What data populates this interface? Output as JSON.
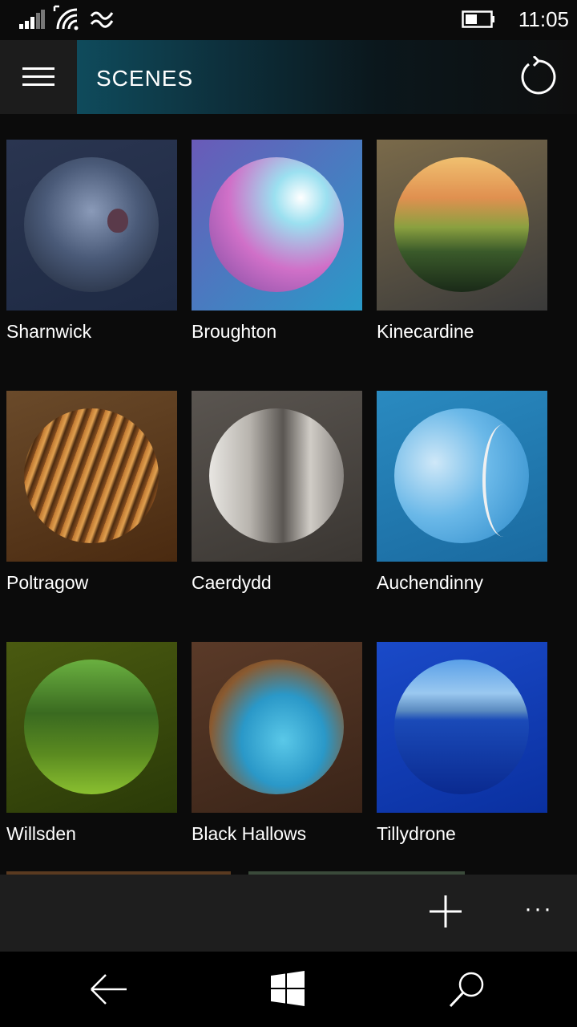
{
  "status_bar": {
    "time": "11:05",
    "icons": [
      "signal-icon",
      "wifi-icon",
      "data-icon",
      "battery-icon"
    ]
  },
  "header": {
    "title": "SCENES",
    "menu_icon": "hamburger-icon",
    "refresh_icon": "refresh-icon"
  },
  "scenes": [
    {
      "name": "Sharnwick"
    },
    {
      "name": "Broughton"
    },
    {
      "name": "Kinecardine"
    },
    {
      "name": "Poltragow"
    },
    {
      "name": "Caerdydd"
    },
    {
      "name": "Auchendinny"
    },
    {
      "name": "Willsden"
    },
    {
      "name": "Black Hallows"
    },
    {
      "name": "Tillydrone"
    }
  ],
  "app_bar": {
    "add_icon": "plus-icon",
    "more_label": "···"
  },
  "nav_bar": {
    "icons": [
      "back-icon",
      "windows-icon",
      "search-icon"
    ]
  }
}
